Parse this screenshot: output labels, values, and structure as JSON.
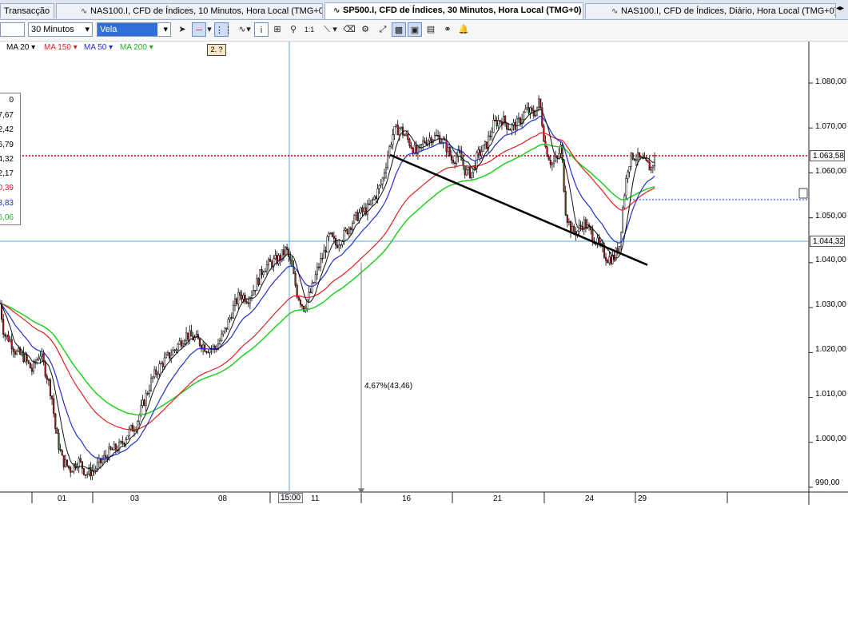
{
  "tabs": [
    {
      "label": "Transacção"
    },
    {
      "label": "NAS100.I, CFD de Índices, 10 Minutos, Hora Local (TMG+0)"
    },
    {
      "label": "SP500.I, CFD de Índices, 30 Minutos, Hora Local (TMG+0)"
    },
    {
      "label": "NAS100.I, CFD de Índices, Diário, Hora Local (TMG+0)"
    }
  ],
  "toolbar": {
    "timeframe_value": "30 Minutos",
    "chart_type_value": "Vela",
    "ratio_label": "1:1"
  },
  "moving_averages": [
    {
      "label": "MA 20",
      "color": "#000000"
    },
    {
      "label": "MA 150",
      "color": "#e02020"
    },
    {
      "label": "MA 50",
      "color": "#2030d0"
    },
    {
      "label": "MA 200",
      "color": "#20d020"
    }
  ],
  "info_badge": "2. ?",
  "side_panel": {
    "values": [
      "7,67",
      "2,42",
      "6,79",
      "4,32",
      "2,17",
      "0,39",
      "3,83",
      "6,06"
    ],
    "header": "0"
  },
  "price_labels": {
    "current": "1.063,58",
    "crosshair": "1.044,32"
  },
  "crosshair_time": "15:00",
  "measure_annotation": "4,67%(43,46)",
  "chart_data": {
    "type": "candlestick",
    "y_ticks": [
      "1.080,00",
      "1.070,00",
      "1.060,00",
      "1.050,00",
      "1.040,00",
      "1.030,00",
      "1.020,00",
      "1.010,00",
      "1.000,00",
      "990,00"
    ],
    "y_tick_values": [
      1080,
      1070,
      1060,
      1050,
      1040,
      1030,
      1020,
      1010,
      1000,
      990
    ],
    "x_ticks": [
      "01",
      "03",
      "08",
      "11",
      "16",
      "21",
      "24",
      "29"
    ],
    "ylim": [
      988.5,
      1084.5
    ],
    "close_path": [
      [
        0,
        1031
      ],
      [
        5,
        1024
      ],
      [
        12,
        1023
      ],
      [
        20,
        1020
      ],
      [
        30,
        1019
      ],
      [
        40,
        1016
      ],
      [
        50,
        1020
      ],
      [
        60,
        1014
      ],
      [
        65,
        1010
      ],
      [
        70,
        1002
      ],
      [
        78,
        996
      ],
      [
        88,
        994
      ],
      [
        98,
        996
      ],
      [
        108,
        993
      ],
      [
        118,
        994
      ],
      [
        128,
        996
      ],
      [
        138,
        998
      ],
      [
        150,
        999
      ],
      [
        160,
        1002
      ],
      [
        170,
        1004
      ],
      [
        180,
        1009
      ],
      [
        190,
        1014
      ],
      [
        200,
        1017
      ],
      [
        210,
        1019
      ],
      [
        220,
        1021
      ],
      [
        232,
        1024
      ],
      [
        245,
        1023
      ],
      [
        258,
        1021
      ],
      [
        270,
        1021
      ],
      [
        282,
        1025
      ],
      [
        292,
        1030
      ],
      [
        300,
        1033
      ],
      [
        310,
        1032
      ],
      [
        320,
        1035
      ],
      [
        330,
        1039
      ],
      [
        340,
        1040
      ],
      [
        350,
        1041
      ],
      [
        358,
        1043
      ],
      [
        365,
        1039
      ],
      [
        372,
        1033
      ],
      [
        380,
        1030
      ],
      [
        390,
        1034
      ],
      [
        398,
        1039
      ],
      [
        405,
        1042
      ],
      [
        412,
        1046
      ],
      [
        420,
        1044
      ],
      [
        430,
        1046
      ],
      [
        440,
        1049
      ],
      [
        450,
        1051
      ],
      [
        460,
        1052
      ],
      [
        470,
        1055
      ],
      [
        478,
        1058
      ],
      [
        485,
        1064
      ],
      [
        492,
        1069
      ],
      [
        500,
        1070
      ],
      [
        508,
        1068
      ],
      [
        515,
        1066
      ],
      [
        522,
        1064
      ],
      [
        530,
        1067
      ],
      [
        540,
        1068
      ],
      [
        550,
        1068
      ],
      [
        558,
        1066
      ],
      [
        565,
        1063
      ],
      [
        575,
        1064
      ],
      [
        583,
        1060
      ],
      [
        590,
        1060
      ],
      [
        598,
        1064
      ],
      [
        608,
        1066
      ],
      [
        618,
        1071
      ],
      [
        628,
        1072
      ],
      [
        638,
        1070
      ],
      [
        648,
        1071
      ],
      [
        658,
        1074
      ],
      [
        668,
        1073
      ],
      [
        675,
        1076
      ],
      [
        682,
        1066
      ],
      [
        690,
        1062
      ],
      [
        697,
        1063
      ],
      [
        702,
        1066
      ],
      [
        708,
        1051
      ],
      [
        715,
        1047
      ],
      [
        722,
        1047
      ],
      [
        730,
        1049
      ],
      [
        738,
        1047
      ],
      [
        745,
        1045
      ],
      [
        752,
        1043
      ],
      [
        760,
        1041
      ],
      [
        768,
        1041
      ],
      [
        775,
        1044
      ],
      [
        780,
        1054
      ],
      [
        786,
        1062
      ],
      [
        792,
        1064
      ],
      [
        800,
        1063
      ],
      [
        808,
        1062
      ],
      [
        815,
        1061
      ],
      [
        820,
        1064
      ]
    ],
    "trendline": {
      "start": [
        488,
        1064
      ],
      "end": [
        810,
        1039.5
      ]
    },
    "measure_arrow": {
      "from": 1040,
      "to": 988.5
    }
  }
}
